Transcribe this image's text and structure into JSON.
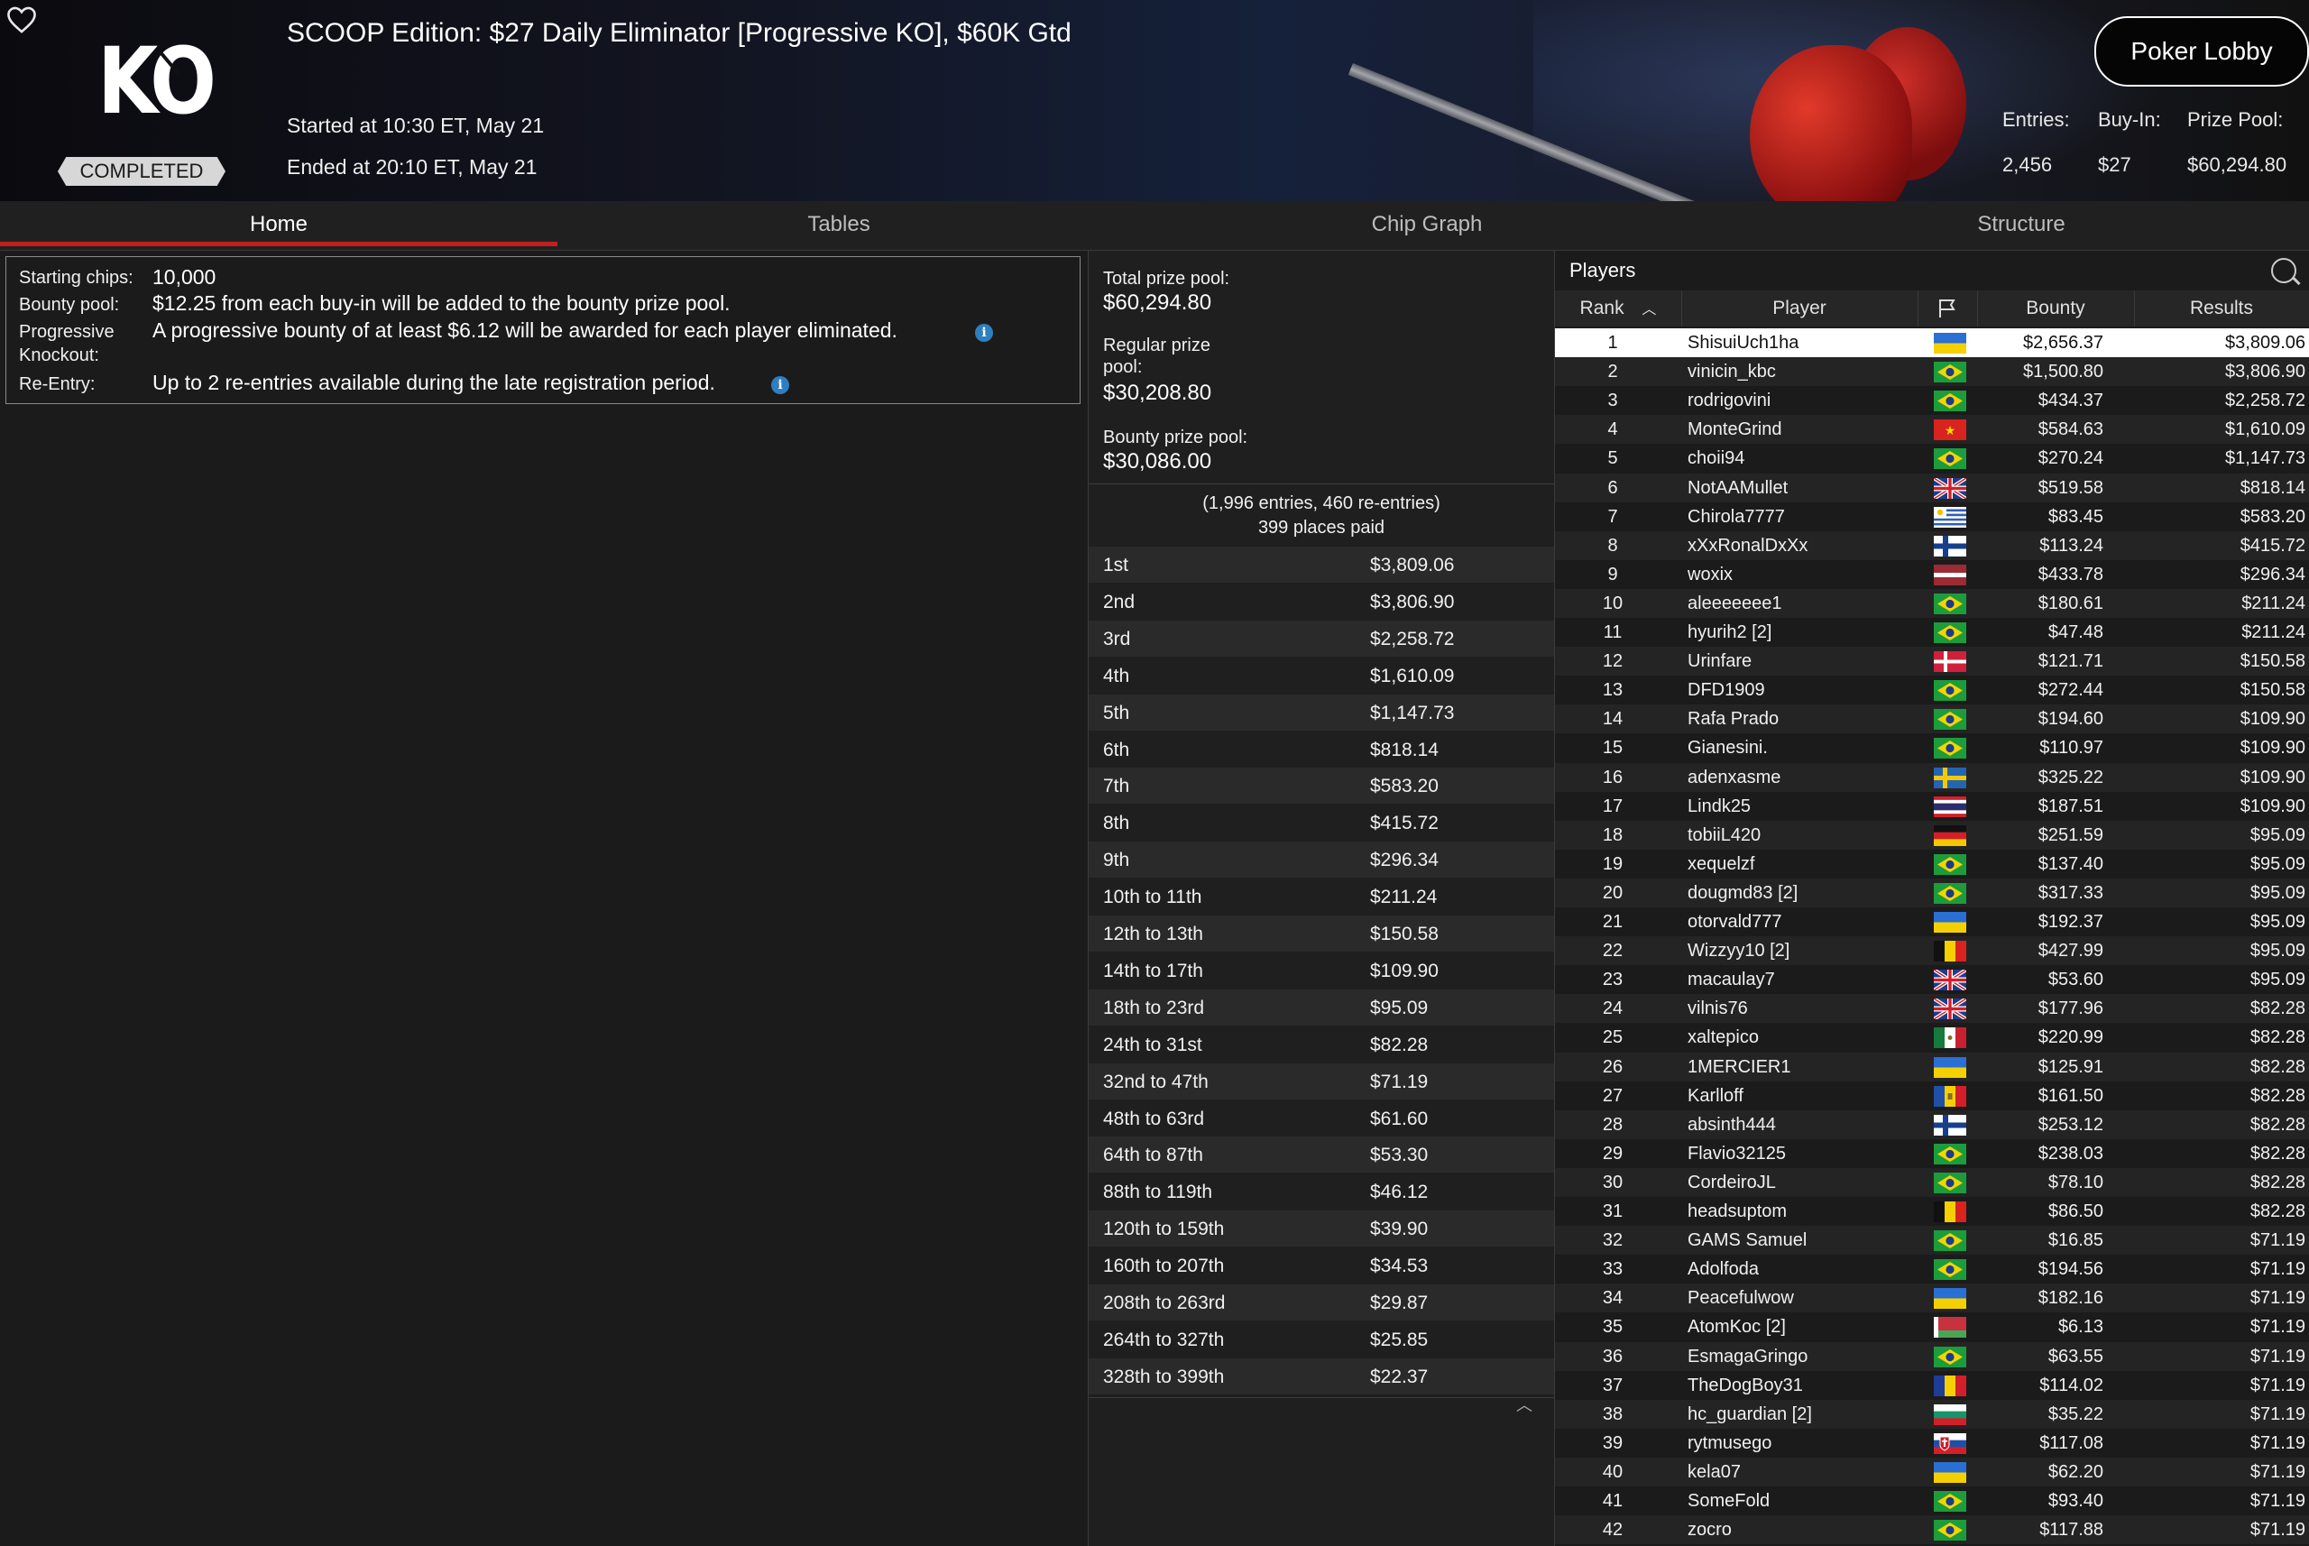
{
  "header": {
    "title": "SCOOP Edition: $27 Daily Eliminator [Progressive KO], $60K Gtd",
    "logo_text": "KO",
    "status": "COMPLETED",
    "started": "Started at 10:30 ET, May 21",
    "ended": "Ended at 20:10 ET, May 21",
    "lobby_button": "Poker Lobby",
    "stats": {
      "entries_label": "Entries:",
      "entries_value": "2,456",
      "buyin_label": "Buy-In:",
      "buyin_value": "$27",
      "prizepool_label": "Prize Pool:",
      "prizepool_value": "$60,294.80"
    }
  },
  "tabs": [
    "Home",
    "Tables",
    "Chip Graph",
    "Structure"
  ],
  "active_tab": "Home",
  "info": {
    "starting_chips_label": "Starting chips:",
    "starting_chips_value": "10,000",
    "bounty_pool_label": "Bounty pool:",
    "bounty_pool_value": "$12.25 from each buy-in will be added to the bounty prize pool.",
    "progressive_label_1": "Progressive",
    "progressive_label_2": "Knockout:",
    "progressive_value": "A progressive bounty of at least $6.12 will be awarded for each player eliminated.",
    "reentry_label": "Re-Entry:",
    "reentry_value": "Up to 2 re-entries available during the late registration period.",
    "info_icon": "i"
  },
  "prize": {
    "total_label": "Total prize pool:",
    "total_value": "$60,294.80",
    "regular_label_1": "Regular prize",
    "regular_label_2": "pool:",
    "regular_value": "$30,208.80",
    "bounty_label": "Bounty prize pool:",
    "bounty_value": "$30,086.00",
    "entries_line": "(1,996 entries, 460 re-entries)",
    "paid_line": "399 places paid",
    "payouts": [
      {
        "place": "1st",
        "amount": "$3,809.06"
      },
      {
        "place": "2nd",
        "amount": "$3,806.90"
      },
      {
        "place": "3rd",
        "amount": "$2,258.72"
      },
      {
        "place": "4th",
        "amount": "$1,610.09"
      },
      {
        "place": "5th",
        "amount": "$1,147.73"
      },
      {
        "place": "6th",
        "amount": "$818.14"
      },
      {
        "place": "7th",
        "amount": "$583.20"
      },
      {
        "place": "8th",
        "amount": "$415.72"
      },
      {
        "place": "9th",
        "amount": "$296.34"
      },
      {
        "place": "10th to 11th",
        "amount": "$211.24"
      },
      {
        "place": "12th to 13th",
        "amount": "$150.58"
      },
      {
        "place": "14th to 17th",
        "amount": "$109.90"
      },
      {
        "place": "18th to 23rd",
        "amount": "$95.09"
      },
      {
        "place": "24th to 31st",
        "amount": "$82.28"
      },
      {
        "place": "32nd to 47th",
        "amount": "$71.19"
      },
      {
        "place": "48th to 63rd",
        "amount": "$61.60"
      },
      {
        "place": "64th to 87th",
        "amount": "$53.30"
      },
      {
        "place": "88th to 119th",
        "amount": "$46.12"
      },
      {
        "place": "120th to 159th",
        "amount": "$39.90"
      },
      {
        "place": "160th to 207th",
        "amount": "$34.53"
      },
      {
        "place": "208th to 263rd",
        "amount": "$29.87"
      },
      {
        "place": "264th to 327th",
        "amount": "$25.85"
      },
      {
        "place": "328th to 399th",
        "amount": "$22.37"
      }
    ]
  },
  "players": {
    "title": "Players",
    "columns": {
      "rank": "Rank",
      "player": "Player",
      "bounty": "Bounty",
      "results": "Results"
    },
    "rows": [
      {
        "rank": "1",
        "name": "ShisuiUch1ha",
        "flag": "ua",
        "bounty": "$2,656.37",
        "result": "$3,809.06"
      },
      {
        "rank": "2",
        "name": "vinicin_kbc",
        "flag": "br",
        "bounty": "$1,500.80",
        "result": "$3,806.90"
      },
      {
        "rank": "3",
        "name": "rodrigovini",
        "flag": "br",
        "bounty": "$434.37",
        "result": "$2,258.72"
      },
      {
        "rank": "4",
        "name": "MonteGrind",
        "flag": "vn",
        "bounty": "$584.63",
        "result": "$1,610.09"
      },
      {
        "rank": "5",
        "name": "choii94",
        "flag": "br",
        "bounty": "$270.24",
        "result": "$1,147.73"
      },
      {
        "rank": "6",
        "name": "NotAAMullet",
        "flag": "gb",
        "bounty": "$519.58",
        "result": "$818.14"
      },
      {
        "rank": "7",
        "name": "Chirola7777",
        "flag": "uy",
        "bounty": "$83.45",
        "result": "$583.20"
      },
      {
        "rank": "8",
        "name": "xXxRonalDxXx",
        "flag": "fi",
        "bounty": "$113.24",
        "result": "$415.72"
      },
      {
        "rank": "9",
        "name": "woxix",
        "flag": "lv",
        "bounty": "$433.78",
        "result": "$296.34"
      },
      {
        "rank": "10",
        "name": "aleeeeeee1",
        "flag": "br",
        "bounty": "$180.61",
        "result": "$211.24"
      },
      {
        "rank": "11",
        "name": "hyurih2 [2]",
        "flag": "br",
        "bounty": "$47.48",
        "result": "$211.24"
      },
      {
        "rank": "12",
        "name": "Urinfare",
        "flag": "dk",
        "bounty": "$121.71",
        "result": "$150.58"
      },
      {
        "rank": "13",
        "name": "DFD1909",
        "flag": "br",
        "bounty": "$272.44",
        "result": "$150.58"
      },
      {
        "rank": "14",
        "name": "Rafa Prado",
        "flag": "br",
        "bounty": "$194.60",
        "result": "$109.90"
      },
      {
        "rank": "15",
        "name": "Gianesini.",
        "flag": "br",
        "bounty": "$110.97",
        "result": "$109.90"
      },
      {
        "rank": "16",
        "name": "adenxasme",
        "flag": "se",
        "bounty": "$325.22",
        "result": "$109.90"
      },
      {
        "rank": "17",
        "name": "Lindk25",
        "flag": "th",
        "bounty": "$187.51",
        "result": "$109.90"
      },
      {
        "rank": "18",
        "name": "tobiiL420",
        "flag": "de",
        "bounty": "$251.59",
        "result": "$95.09"
      },
      {
        "rank": "19",
        "name": "xequelzf",
        "flag": "br",
        "bounty": "$137.40",
        "result": "$95.09"
      },
      {
        "rank": "20",
        "name": "dougmd83 [2]",
        "flag": "br",
        "bounty": "$317.33",
        "result": "$95.09"
      },
      {
        "rank": "21",
        "name": "otorvald777",
        "flag": "ua",
        "bounty": "$192.37",
        "result": "$95.09"
      },
      {
        "rank": "22",
        "name": "Wizzyy10 [2]",
        "flag": "be",
        "bounty": "$427.99",
        "result": "$95.09"
      },
      {
        "rank": "23",
        "name": "macaulay7",
        "flag": "gb",
        "bounty": "$53.60",
        "result": "$95.09"
      },
      {
        "rank": "24",
        "name": "vilnis76",
        "flag": "gb",
        "bounty": "$177.96",
        "result": "$82.28"
      },
      {
        "rank": "25",
        "name": "xaltepico",
        "flag": "mx",
        "bounty": "$220.99",
        "result": "$82.28"
      },
      {
        "rank": "26",
        "name": "1MERCIER1",
        "flag": "ua",
        "bounty": "$125.91",
        "result": "$82.28"
      },
      {
        "rank": "27",
        "name": "Karlloff",
        "flag": "md",
        "bounty": "$161.50",
        "result": "$82.28"
      },
      {
        "rank": "28",
        "name": "absinth444",
        "flag": "fi",
        "bounty": "$253.12",
        "result": "$82.28"
      },
      {
        "rank": "29",
        "name": "Flavio32125",
        "flag": "br",
        "bounty": "$238.03",
        "result": "$82.28"
      },
      {
        "rank": "30",
        "name": "CordeiroJL",
        "flag": "br",
        "bounty": "$78.10",
        "result": "$82.28"
      },
      {
        "rank": "31",
        "name": "headsuptom",
        "flag": "be",
        "bounty": "$86.50",
        "result": "$82.28"
      },
      {
        "rank": "32",
        "name": "GAMS Samuel",
        "flag": "br",
        "bounty": "$16.85",
        "result": "$71.19"
      },
      {
        "rank": "33",
        "name": "Adolfoda",
        "flag": "br",
        "bounty": "$194.56",
        "result": "$71.19"
      },
      {
        "rank": "34",
        "name": "Peacefulwow",
        "flag": "ua",
        "bounty": "$182.16",
        "result": "$71.19"
      },
      {
        "rank": "35",
        "name": "AtomKoc [2]",
        "flag": "by",
        "bounty": "$6.13",
        "result": "$71.19"
      },
      {
        "rank": "36",
        "name": "EsmagaGringo",
        "flag": "br",
        "bounty": "$63.55",
        "result": "$71.19"
      },
      {
        "rank": "37",
        "name": "TheDogBoy31",
        "flag": "ro",
        "bounty": "$114.02",
        "result": "$71.19"
      },
      {
        "rank": "38",
        "name": "hc_guardian [2]",
        "flag": "bg",
        "bounty": "$35.22",
        "result": "$71.19"
      },
      {
        "rank": "39",
        "name": "rytmusego",
        "flag": "sk",
        "bounty": "$117.08",
        "result": "$71.19"
      },
      {
        "rank": "40",
        "name": "kela07",
        "flag": "ua",
        "bounty": "$62.20",
        "result": "$71.19"
      },
      {
        "rank": "41",
        "name": "SomeFold",
        "flag": "br",
        "bounty": "$93.40",
        "result": "$71.19"
      },
      {
        "rank": "42",
        "name": "zocro",
        "flag": "br",
        "bounty": "$117.88",
        "result": "$71.19"
      }
    ]
  },
  "colors": {
    "accent": "#c41f1f",
    "info_icon": "#2d7fc1",
    "selected_row": "#ffffff"
  }
}
